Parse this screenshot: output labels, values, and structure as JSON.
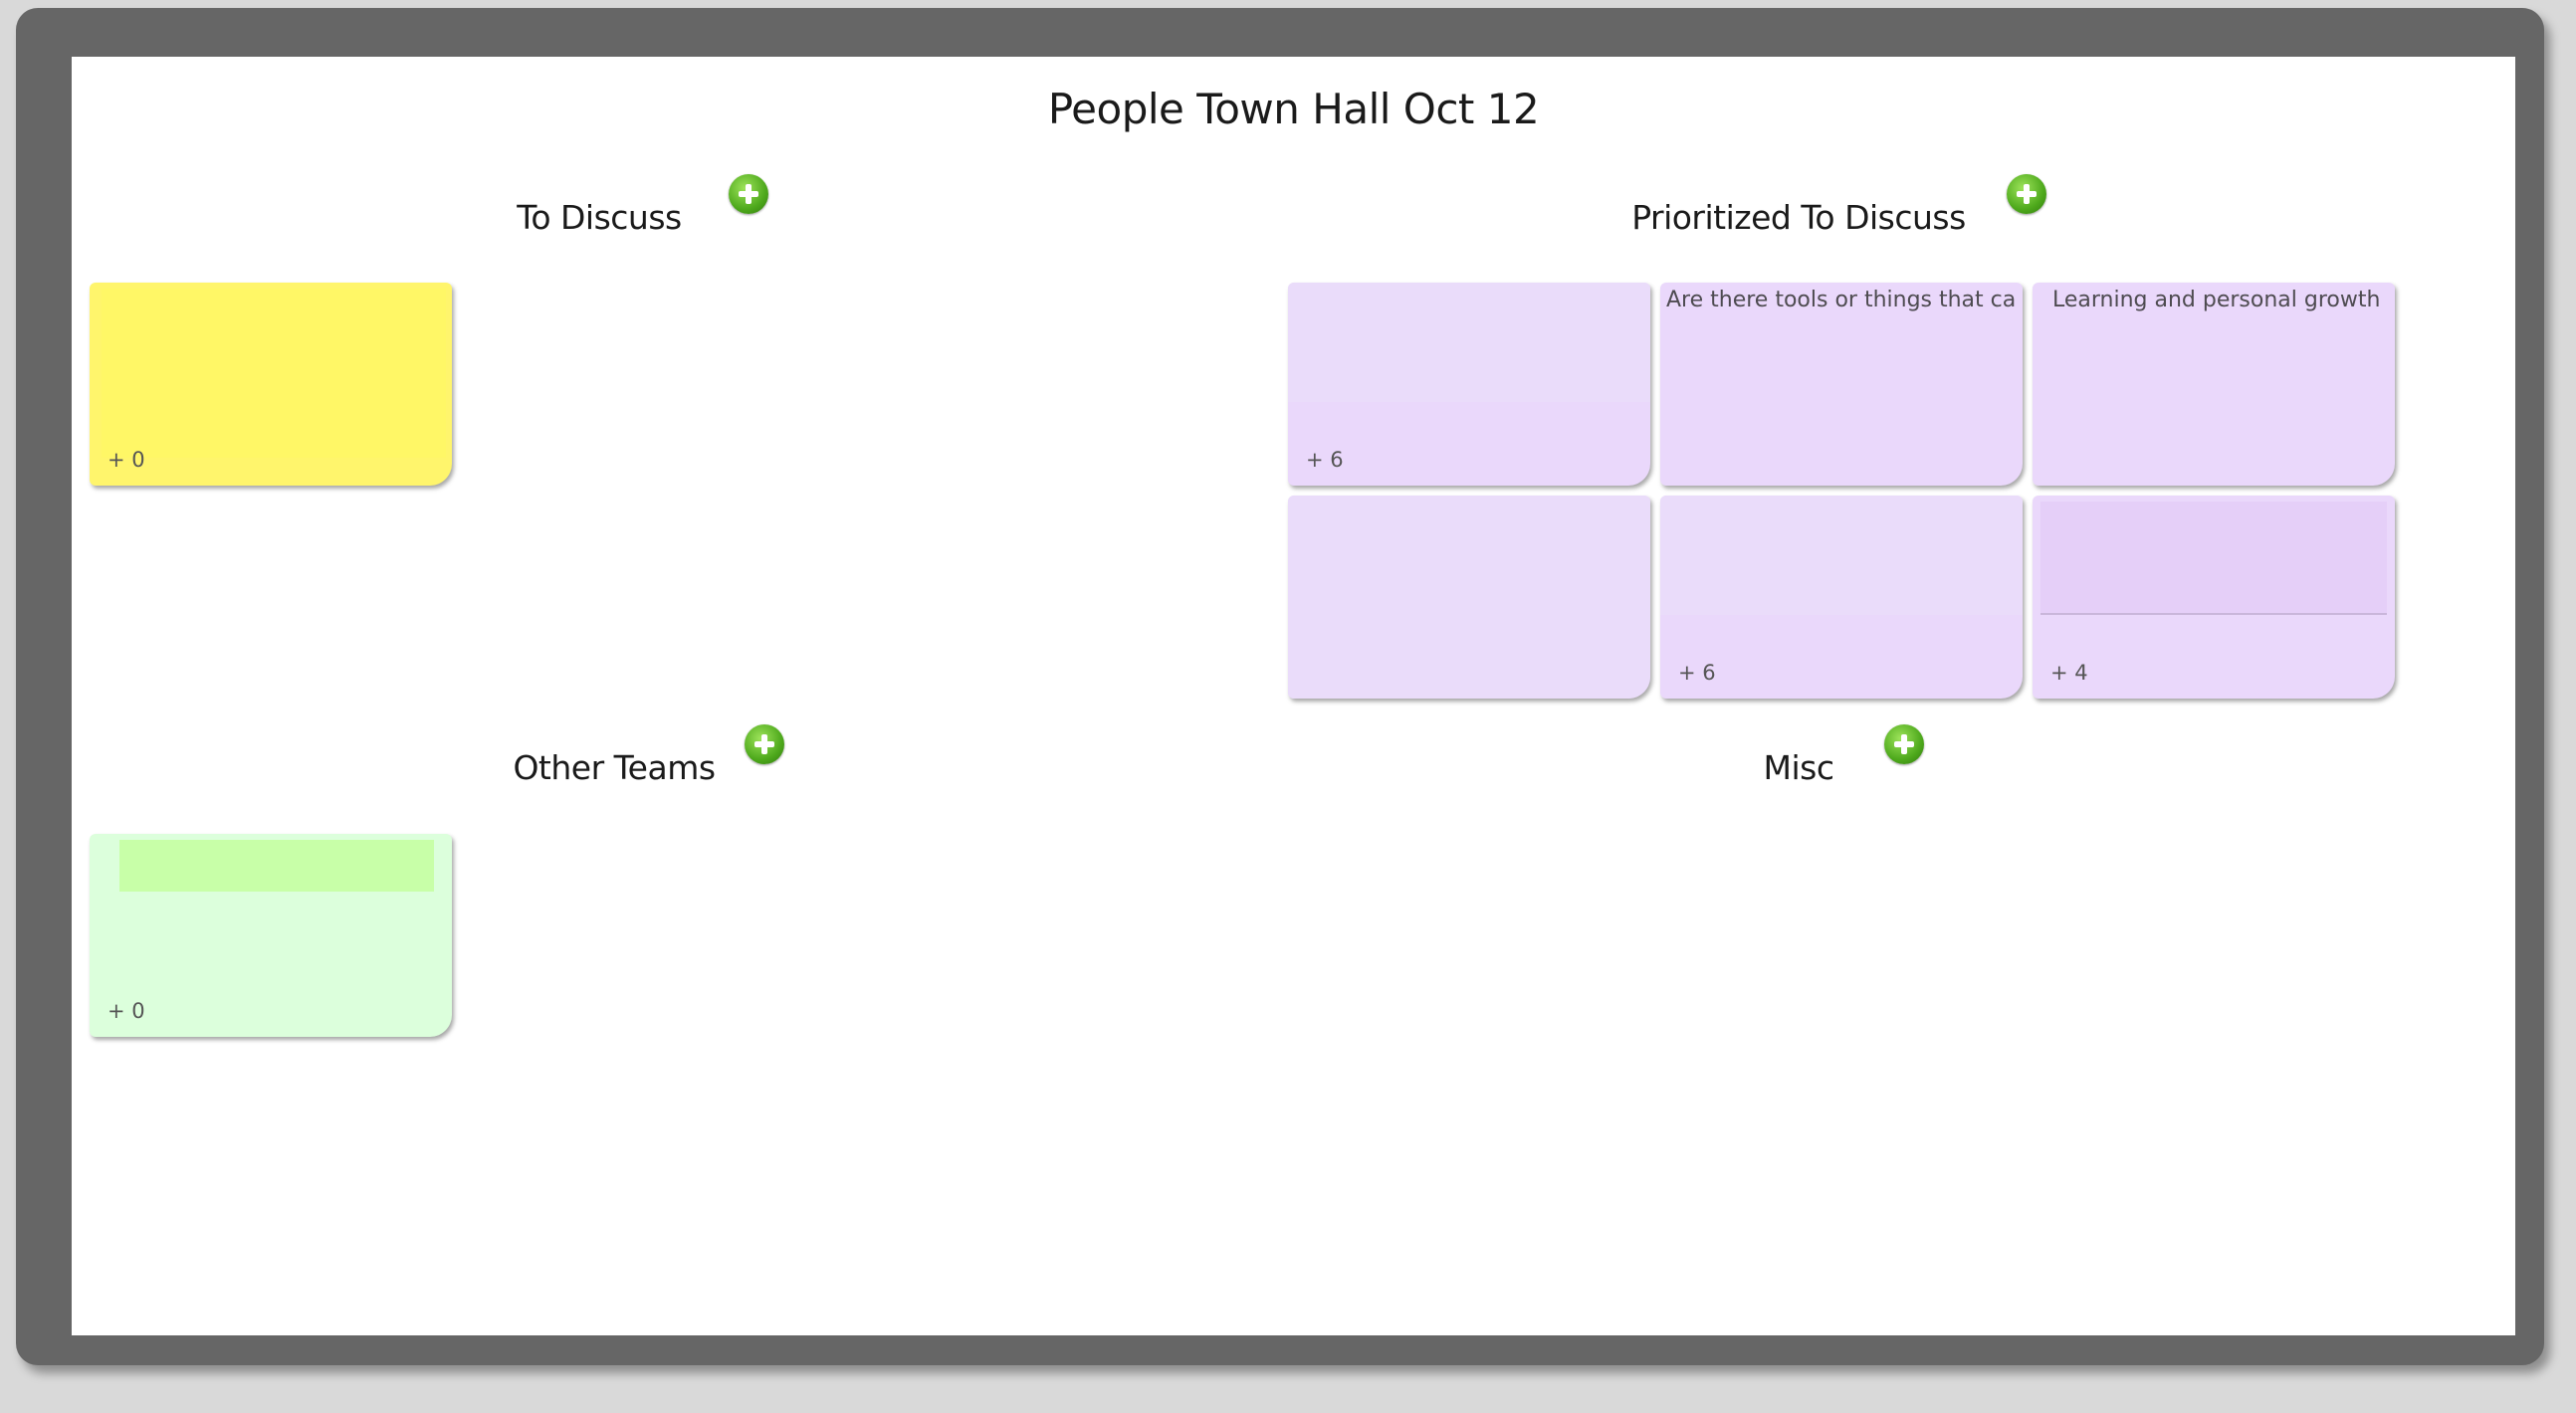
{
  "board": {
    "title": "People Town Hall Oct 12"
  },
  "columns": {
    "to_discuss": {
      "label": "To Discuss",
      "notes": [
        {
          "votes": "+ 0",
          "color": "#fff56c"
        }
      ]
    },
    "prioritized": {
      "label": "Prioritized To Discuss",
      "notes": [
        {
          "text": "",
          "votes": "+ 6",
          "color": "#ead8fb"
        },
        {
          "text": "Are there tools or things that can",
          "votes": "",
          "color": "#ead8fb"
        },
        {
          "text": "Learning and personal growth",
          "votes": "",
          "color": "#ead8fb"
        },
        {
          "text": "",
          "votes": "",
          "color": "#ead8fb"
        },
        {
          "text": "",
          "votes": "+ 6",
          "color": "#ead8fb"
        },
        {
          "text": "",
          "votes": "+ 4",
          "color": "#ead8fb"
        }
      ]
    },
    "other_teams": {
      "label": "Other Teams",
      "notes": [
        {
          "votes": "+ 0",
          "color": "#dcffdc"
        }
      ]
    },
    "misc": {
      "label": "Misc",
      "notes": []
    }
  },
  "icons": {
    "add": "plus-circle-icon"
  }
}
